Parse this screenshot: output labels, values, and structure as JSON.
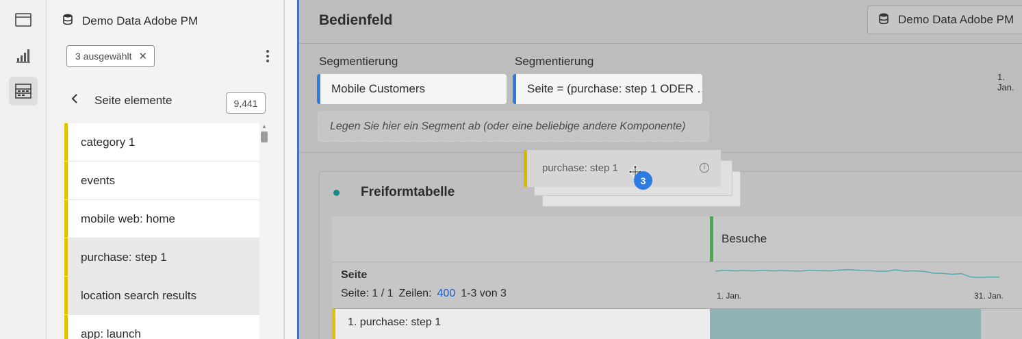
{
  "rail": {
    "icons": [
      "panel-icon",
      "visualization-icon",
      "components-icon"
    ]
  },
  "panel": {
    "datasource": "Demo Data Adobe PM",
    "filter_chip": "3 ausgewählt",
    "back_label": "Seite elemente",
    "count": "9,441",
    "items": [
      {
        "label": "category 1",
        "selected": false
      },
      {
        "label": "events",
        "selected": false
      },
      {
        "label": "mobile web: home",
        "selected": false
      },
      {
        "label": "purchase: step 1",
        "selected": true
      },
      {
        "label": "location search results",
        "selected": true
      },
      {
        "label": "app: launch",
        "selected": false
      }
    ]
  },
  "workspace": {
    "title": "Bedienfeld",
    "datasource": "Demo Data Adobe PM",
    "segments": [
      {
        "label": "Segmentierung",
        "value": "Mobile Customers"
      },
      {
        "label": "Segmentierung",
        "value": "Seite = (purchase: step 1 ODER …"
      }
    ],
    "drop_zone": "Legen Sie hier ein Segment ab (oder eine beliebige andere Komponente)",
    "date_label": "1. Jan.",
    "freeform": {
      "title": "Freiformtabelle",
      "metric": "Besuche",
      "dimension": "Seite",
      "page_info": "Seite: 1 / 1",
      "rows_label": "Zeilen:",
      "rows_value": "400",
      "range": "1-3 von 3",
      "spark_start": "1. Jan.",
      "spark_end": "31. Jan.",
      "row1_label": "1. purchase: step 1",
      "row1_share": 0.88
    }
  },
  "drag": {
    "label": "purchase: step 1",
    "count": "3"
  },
  "colors": {
    "segment_accent": "#2f7be0",
    "metric_accent": "#40b04d",
    "dimension_accent": "#e0c300",
    "sparkline": "#5aacb0",
    "link": "#1a5cc7"
  },
  "sparkline_values": [
    0.79,
    0.82,
    0.8,
    0.81,
    0.8,
    0.82,
    0.8,
    0.81,
    0.8,
    0.79,
    0.82,
    0.81,
    0.8,
    0.82,
    0.84,
    0.82,
    0.81,
    0.79,
    0.78,
    0.83,
    0.79,
    0.8,
    0.78,
    0.72,
    0.71,
    0.68,
    0.7,
    0.58,
    0.57,
    0.58,
    0.58
  ]
}
